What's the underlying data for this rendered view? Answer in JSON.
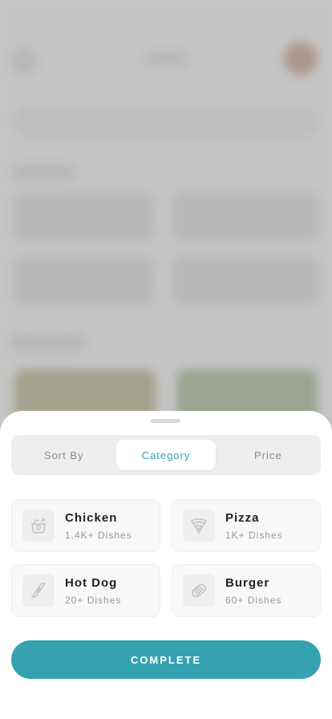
{
  "sheet": {
    "tabs": [
      {
        "label": "Sort By",
        "active": false
      },
      {
        "label": "Category",
        "active": true
      },
      {
        "label": "Price",
        "active": false
      }
    ],
    "categories": [
      {
        "title": "Chicken",
        "subtitle": "1.4K+ Dishes",
        "icon": "chicken-icon"
      },
      {
        "title": "Pizza",
        "subtitle": "1K+ Dishes",
        "icon": "pizza-icon"
      },
      {
        "title": "Hot Dog",
        "subtitle": "20+ Dishes",
        "icon": "hot-dog-icon"
      },
      {
        "title": "Burger",
        "subtitle": "60+ Dishes",
        "icon": "burger-icon"
      }
    ],
    "complete_label": "COMPLETE"
  },
  "colors": {
    "accent": "#34a2b1",
    "overlay": "#8c8c8c"
  }
}
